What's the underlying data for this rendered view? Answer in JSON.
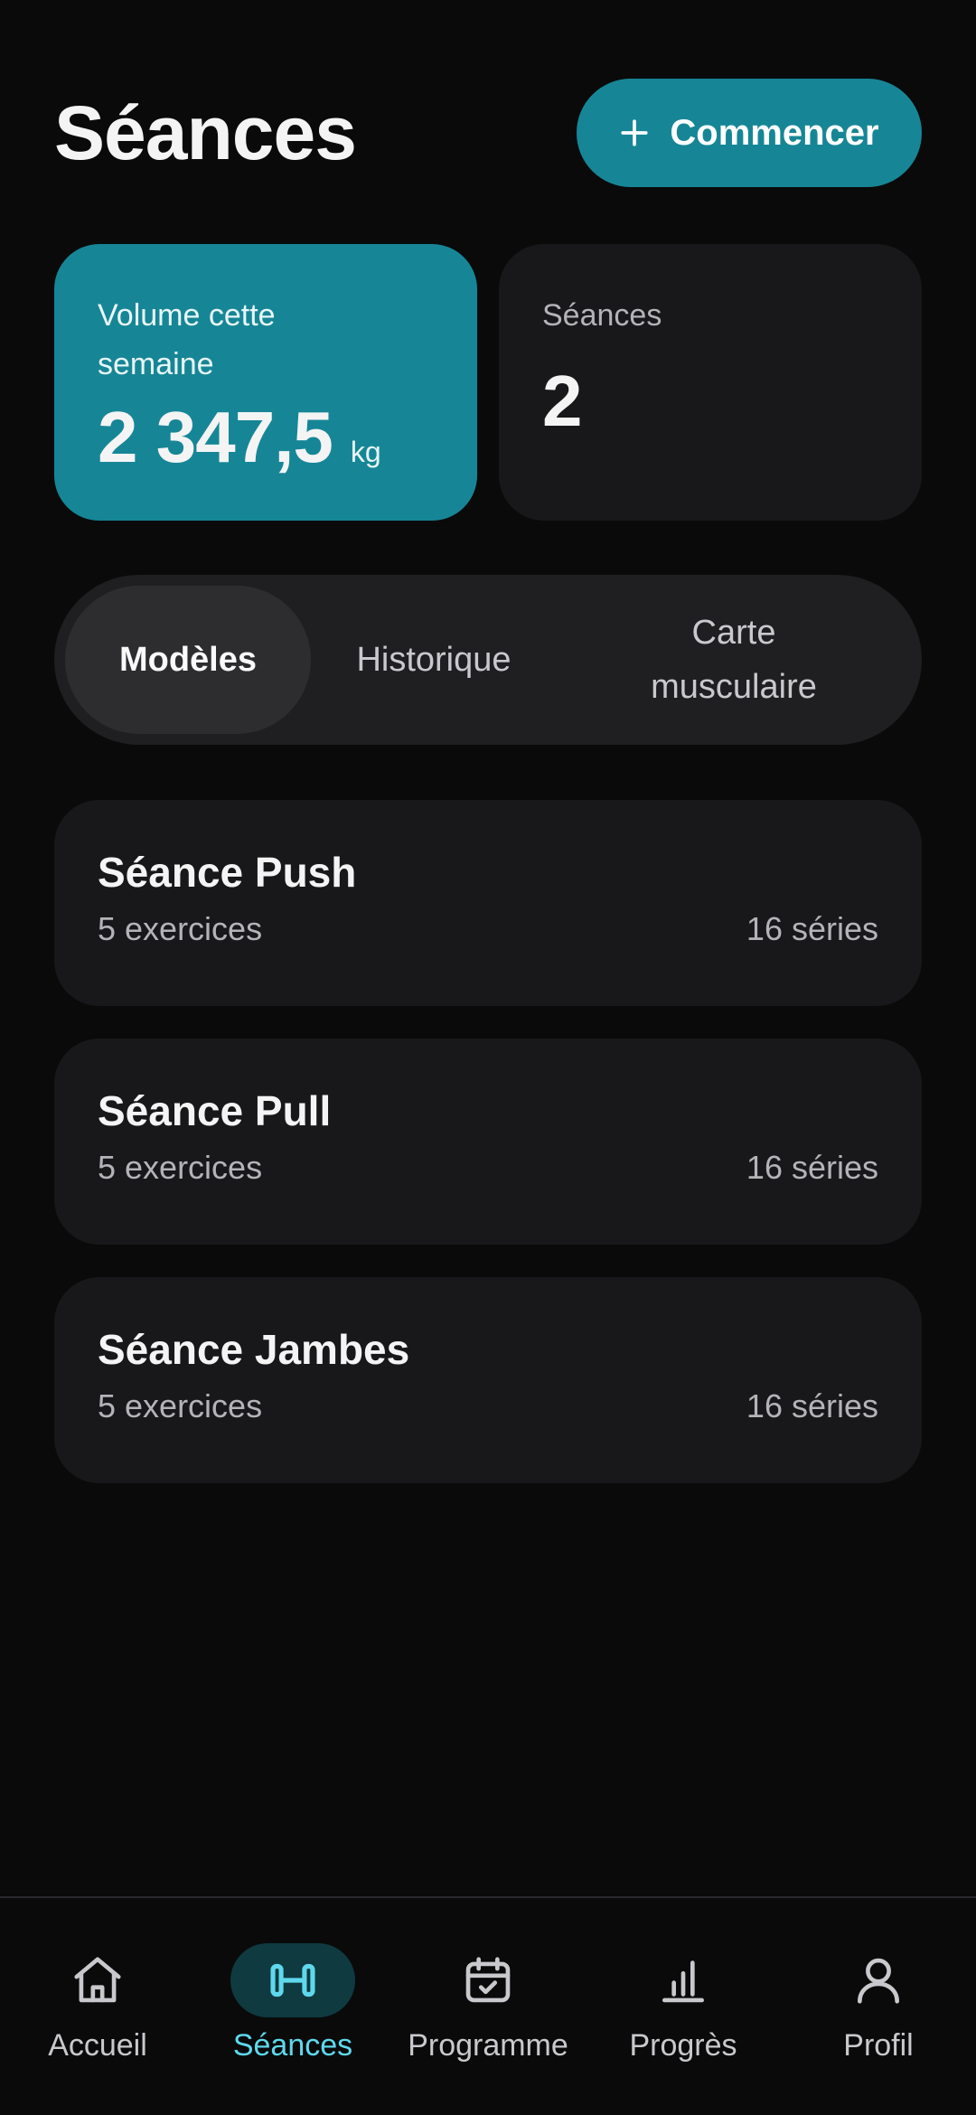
{
  "header": {
    "title": "Séances",
    "start_button_label": "Commencer"
  },
  "stats": {
    "volume": {
      "label": "Volume cette semaine",
      "value": "2 347,5",
      "unit": "kg"
    },
    "sessions": {
      "label": "Séances",
      "value": "2"
    }
  },
  "tabs": [
    {
      "label": "Modèles",
      "active": true
    },
    {
      "label": "Historique",
      "active": false
    },
    {
      "label": "Carte musculaire",
      "active": false
    }
  ],
  "templates": [
    {
      "name": "Séance Push",
      "exercises": "5 exercices",
      "sets": "16 séries"
    },
    {
      "name": "Séance Pull",
      "exercises": "5 exercices",
      "sets": "16 séries"
    },
    {
      "name": "Séance Jambes",
      "exercises": "5 exercices",
      "sets": "16 séries"
    }
  ],
  "nav": [
    {
      "label": "Accueil",
      "icon": "home-icon",
      "active": false
    },
    {
      "label": "Séances",
      "icon": "dumbbell-icon",
      "active": true
    },
    {
      "label": "Programme",
      "icon": "calendar-check-icon",
      "active": false
    },
    {
      "label": "Progrès",
      "icon": "bar-chart-icon",
      "active": false
    },
    {
      "label": "Profil",
      "icon": "user-icon",
      "active": false
    }
  ],
  "colors": {
    "accent": "#168696",
    "accent_light": "#5fd8ec",
    "background": "#0a0a0b",
    "card": "#18181a"
  }
}
